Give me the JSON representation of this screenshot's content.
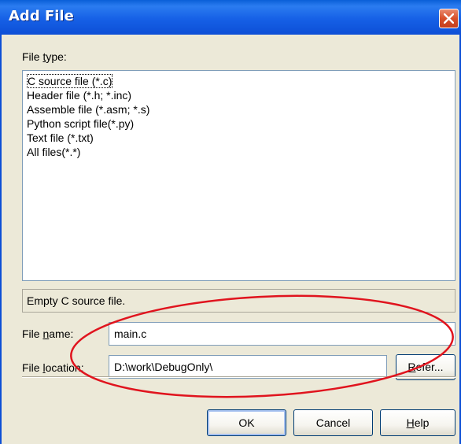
{
  "window": {
    "title": "Add File"
  },
  "file_type": {
    "label_pre": "File ",
    "label_accel": "t",
    "label_post": "ype:",
    "items": [
      {
        "label": "C source file (*.c)",
        "selected": true
      },
      {
        "label": "Header file (*.h; *.inc)",
        "selected": false
      },
      {
        "label": "Assemble file (*.asm; *.s)",
        "selected": false
      },
      {
        "label": "Python script file(*.py)",
        "selected": false
      },
      {
        "label": "Text file (*.txt)",
        "selected": false
      },
      {
        "label": "All files(*.*)",
        "selected": false
      }
    ],
    "description": "Empty C source file."
  },
  "file_name": {
    "label_pre": "File ",
    "label_accel": "n",
    "label_post": "ame:",
    "value": "main.c"
  },
  "file_location": {
    "label_pre": "File ",
    "label_accel": "l",
    "label_post": "ocation:",
    "value": "D:\\work\\DebugOnly\\",
    "refer_accel": "R",
    "refer_post": "efer..."
  },
  "buttons": {
    "ok": "OK",
    "cancel": "Cancel",
    "help_accel": "H",
    "help_post": "elp"
  },
  "colors": {
    "titlebar": "#1660e6",
    "dialog_bg": "#ece9d8",
    "annotation_ellipse": "#e0141e"
  }
}
